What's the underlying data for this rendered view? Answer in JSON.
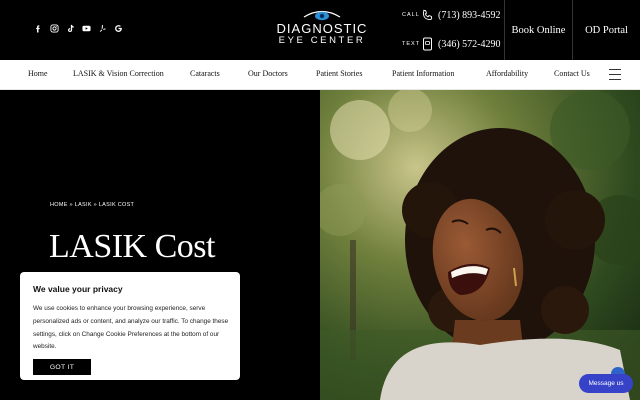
{
  "header": {
    "social_icons": [
      "facebook-icon",
      "instagram-icon",
      "tiktok-icon",
      "youtube-icon",
      "yelp-icon",
      "google-icon"
    ],
    "logo": {
      "line1": "DIAGNOSTIC",
      "line2": "EYE CENTER"
    },
    "call": {
      "label": "CALL",
      "number": "(713) 893-4592"
    },
    "text": {
      "label": "TEXT",
      "number": "(346) 572-4290"
    },
    "book_online": "Book Online",
    "od_portal": "OD Portal"
  },
  "nav": {
    "items": [
      "Home",
      "LASIK & Vision Correction",
      "Cataracts",
      "Our Doctors",
      "Patient Stories",
      "Patient Information",
      "Affordability",
      "Contact Us"
    ],
    "menu_icon": "hamburger-menu-icon"
  },
  "hero": {
    "breadcrumb": "HOME » LASIK » LASIK COST",
    "title": "LASIK Cost"
  },
  "cookie": {
    "title": "We value your privacy",
    "body": "We use cookies to enhance your browsing experience, serve personalized ads or content, and analyze our traffic. To change these settings, click on Change Cookie Preferences at the bottom of our website.",
    "button": "GOT IT"
  },
  "message_widget": "Message us",
  "colors": {
    "header_bg": "#000000",
    "nav_bg": "#ffffff",
    "logo_accent": "#2a8fd6",
    "message_btn": "#3642c8"
  }
}
